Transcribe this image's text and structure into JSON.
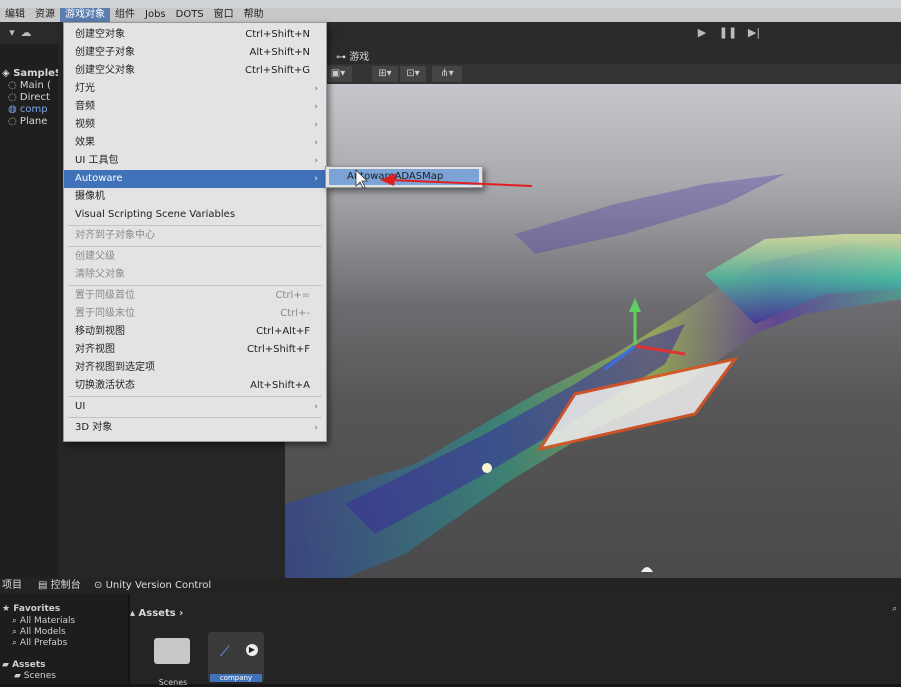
{
  "menubar": {
    "items": [
      "编辑",
      "资源",
      "游戏对象",
      "组件",
      "Jobs",
      "DOTS",
      "窗口",
      "帮助"
    ]
  },
  "hierarchy": {
    "items": [
      "SampleS",
      "Main (",
      "Direct",
      "comp",
      "Plane"
    ]
  },
  "scene": {
    "game_tab_label": "游戏"
  },
  "menu": {
    "items": [
      {
        "label": "创建空对象",
        "shortcut": "Ctrl+Shift+N"
      },
      {
        "label": "创建空子对象",
        "shortcut": "Alt+Shift+N"
      },
      {
        "label": "创建空父对象",
        "shortcut": "Ctrl+Shift+G"
      },
      {
        "label": "灯光",
        "shortcut": ""
      },
      {
        "label": "音频",
        "shortcut": ""
      },
      {
        "label": "视频",
        "shortcut": ""
      },
      {
        "label": "效果",
        "shortcut": ""
      },
      {
        "label": "UI 工具包",
        "shortcut": ""
      },
      {
        "label": "Autoware",
        "shortcut": ""
      },
      {
        "label": "摄像机",
        "shortcut": ""
      },
      {
        "label": "Visual Scripting Scene Variables",
        "shortcut": ""
      },
      {
        "label": "对齐到子对象中心",
        "shortcut": ""
      },
      {
        "label": "创建父级",
        "shortcut": ""
      },
      {
        "label": "清除父对象",
        "shortcut": ""
      },
      {
        "label": "置于同级首位",
        "shortcut": "Ctrl+="
      },
      {
        "label": "置于同级末位",
        "shortcut": "Ctrl+-"
      },
      {
        "label": "移动到视图",
        "shortcut": "Ctrl+Alt+F"
      },
      {
        "label": "对齐视图",
        "shortcut": "Ctrl+Shift+F"
      },
      {
        "label": "对齐视图到选定项",
        "shortcut": ""
      },
      {
        "label": "切换激活状态",
        "shortcut": "Alt+Shift+A"
      },
      {
        "label": "UI",
        "shortcut": ""
      },
      {
        "label": "3D 对象",
        "shortcut": ""
      }
    ]
  },
  "submenu": {
    "item": "AutowareADASMap"
  },
  "bottom": {
    "tabs": [
      "项目",
      "控制台",
      "Unity Version Control"
    ],
    "favorites_label": "Favorites",
    "favorites": [
      "All Materials",
      "All Models",
      "All Prefabs"
    ],
    "assets_label": "Assets",
    "assets_children": [
      "Scenes"
    ],
    "breadcrumb": "Assets",
    "asset_items": [
      "Scenes",
      "company"
    ]
  }
}
